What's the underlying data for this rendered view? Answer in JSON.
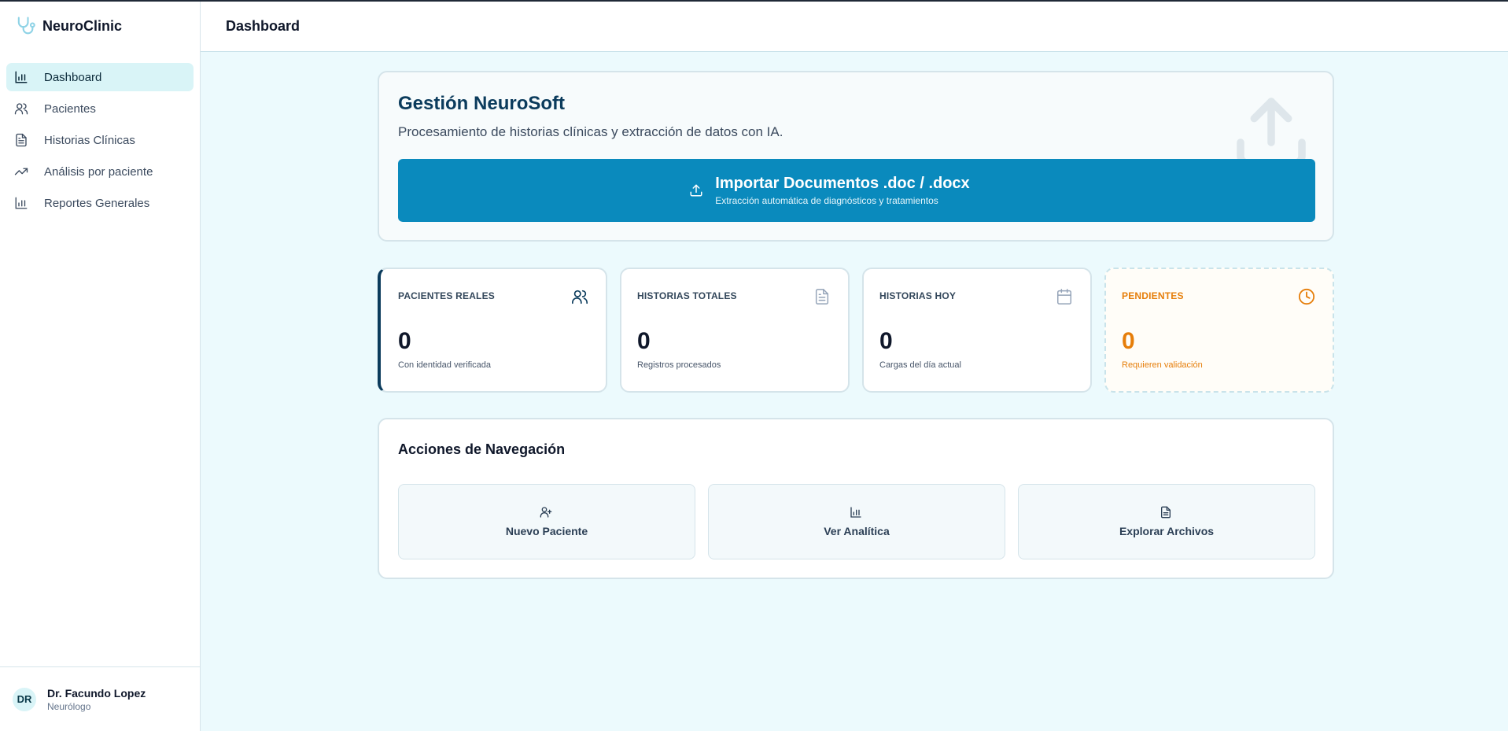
{
  "app": {
    "name": "NeuroClinic",
    "logo_icon": "stethoscope-icon"
  },
  "sidebar": {
    "items": [
      {
        "label": "Dashboard",
        "icon": "bar-chart-icon",
        "active": true
      },
      {
        "label": "Pacientes",
        "icon": "users-icon",
        "active": false
      },
      {
        "label": "Historias Clínicas",
        "icon": "file-text-icon",
        "active": false
      },
      {
        "label": "Análisis por paciente",
        "icon": "trending-up-icon",
        "active": false
      },
      {
        "label": "Reportes Generales",
        "icon": "bar-chart-icon",
        "active": false
      }
    ]
  },
  "user": {
    "initials": "DR",
    "name": "Dr. Facundo Lopez",
    "role": "Neurólogo"
  },
  "header": {
    "title": "Dashboard"
  },
  "hero": {
    "title": "Gestión NeuroSoft",
    "subtitle": "Procesamiento de historias clínicas y extracción de datos con IA.",
    "import_button": {
      "title": "Importar Documentos .doc / .docx",
      "subtitle": "Extracción automática de diagnósticos y tratamientos",
      "icon": "upload-icon"
    }
  },
  "stats": [
    {
      "label": "PACIENTES REALES",
      "value": "0",
      "note": "Con identidad verificada",
      "icon": "users-icon"
    },
    {
      "label": "HISTORIAS TOTALES",
      "value": "0",
      "note": "Registros procesados",
      "icon": "file-text-icon"
    },
    {
      "label": "HISTORIAS HOY",
      "value": "0",
      "note": "Cargas del día actual",
      "icon": "calendar-icon"
    },
    {
      "label": "PENDIENTES",
      "value": "0",
      "note": "Requieren validación",
      "icon": "clock-icon"
    }
  ],
  "actions": {
    "title": "Acciones de Navegación",
    "items": [
      {
        "label": "Nuevo Paciente",
        "icon": "user-plus-icon"
      },
      {
        "label": "Ver Analítica",
        "icon": "bar-chart-icon"
      },
      {
        "label": "Explorar Archivos",
        "icon": "file-text-icon"
      }
    ]
  },
  "colors": {
    "accent": "#0a8abd",
    "primary_dark": "#0b3b5c",
    "warning": "#e67e0a",
    "page_bg": "#ecfafd",
    "active_nav": "#d9f4f7"
  }
}
